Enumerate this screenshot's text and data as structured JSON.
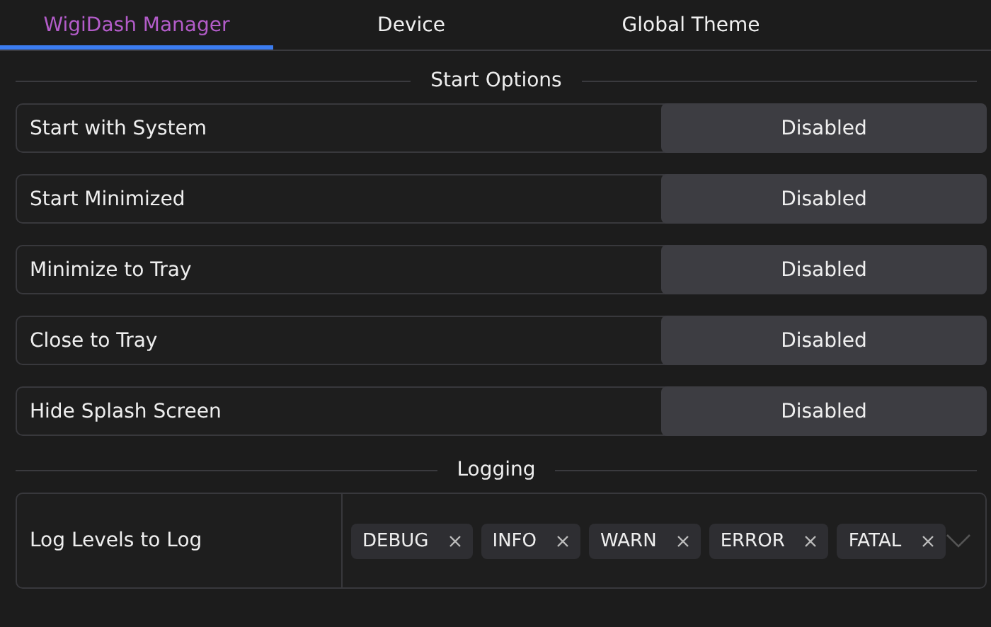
{
  "tabs": [
    {
      "label": "WigiDash Manager",
      "selected": true
    },
    {
      "label": "Device",
      "selected": false
    },
    {
      "label": "Global Theme",
      "selected": false
    }
  ],
  "sections": [
    {
      "title": "Start Options",
      "rows": [
        {
          "kind": "toggle",
          "label": "Start with System",
          "value": "Disabled"
        },
        {
          "kind": "toggle",
          "label": "Start Minimized",
          "value": "Disabled"
        },
        {
          "kind": "toggle",
          "label": "Minimize to Tray",
          "value": "Disabled"
        },
        {
          "kind": "toggle",
          "label": "Close to Tray",
          "value": "Disabled"
        },
        {
          "kind": "toggle",
          "label": "Hide Splash Screen",
          "value": "Disabled"
        }
      ]
    },
    {
      "title": "Logging",
      "rows": [
        {
          "kind": "multiselect",
          "label": "Log Levels to Log",
          "tags": [
            "DEBUG",
            "INFO",
            "WARN",
            "ERROR",
            "FATAL"
          ]
        }
      ]
    }
  ]
}
